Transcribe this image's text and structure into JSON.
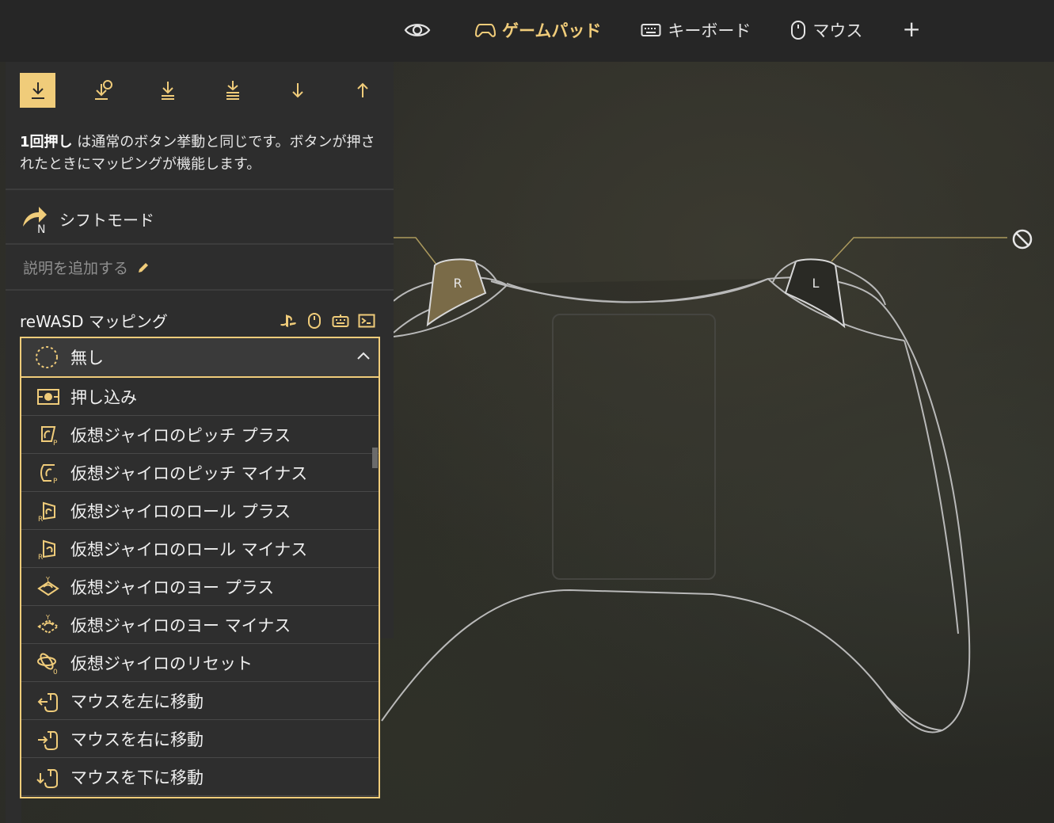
{
  "topnav": {
    "items": [
      {
        "id": "view",
        "label": "",
        "icon": "eye-icon"
      },
      {
        "id": "gamepad",
        "label": "ゲームパッド",
        "icon": "gamepad-icon",
        "active": true
      },
      {
        "id": "keyboard",
        "label": "キーボード",
        "icon": "keyboard-icon"
      },
      {
        "id": "mouse",
        "label": "マウス",
        "icon": "mouse-icon"
      },
      {
        "id": "add",
        "label": "+",
        "icon": "plus-icon"
      }
    ]
  },
  "activation_modes": {
    "selected_index": 0,
    "icons": [
      "single-press-icon",
      "start-press-icon",
      "long-press-icon",
      "double-press-icon",
      "down-icon",
      "up-icon"
    ]
  },
  "description": {
    "bold": "1回押し",
    "text": " は通常のボタン挙動と同じです。ボタンが押されたときにマッピングが機能します。"
  },
  "shift": {
    "label": "シフトモード",
    "badge": "N"
  },
  "add_note": {
    "label": "説明を追加する"
  },
  "mapping": {
    "title": "reWASD マッピング",
    "type_icons": [
      "playstation-icon",
      "mouse-icon",
      "keyboard-icon",
      "macro-icon"
    ],
    "selected": "無し"
  },
  "dropdown": {
    "items": [
      {
        "label": "押し込み",
        "icon": "stick-press-icon"
      },
      {
        "label": "仮想ジャイロのピッチ プラス",
        "icon": "gyro-pitch-plus-icon"
      },
      {
        "label": "仮想ジャイロのピッチ マイナス",
        "icon": "gyro-pitch-minus-icon"
      },
      {
        "label": "仮想ジャイロのロール プラス",
        "icon": "gyro-roll-plus-icon"
      },
      {
        "label": "仮想ジャイロのロール マイナス",
        "icon": "gyro-roll-minus-icon"
      },
      {
        "label": "仮想ジャイロのヨー プラス",
        "icon": "gyro-yaw-plus-icon"
      },
      {
        "label": "仮想ジャイロのヨー マイナス",
        "icon": "gyro-yaw-minus-icon"
      },
      {
        "label": "仮想ジャイロのリセット",
        "icon": "gyro-reset-icon"
      },
      {
        "label": "マウスを左に移動",
        "icon": "mouse-left-icon"
      },
      {
        "label": "マウスを右に移動",
        "icon": "mouse-right-icon"
      },
      {
        "label": "マウスを下に移動",
        "icon": "mouse-down-icon"
      }
    ]
  },
  "controller": {
    "right_trigger": "R",
    "left_trigger": "L",
    "accent": "#f0cc7a"
  }
}
